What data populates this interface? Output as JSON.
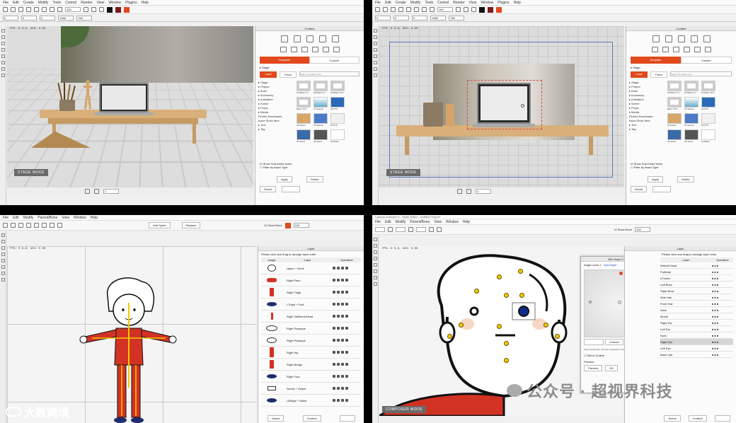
{
  "q1": {
    "menu": [
      "File",
      "Edit",
      "Create",
      "Modify",
      "Tools",
      "Control",
      "Render",
      "View",
      "Window",
      "Plugins",
      "Help"
    ],
    "toolbar": {
      "zoom": "100",
      "field_x": "0",
      "field_y": "0",
      "field_z": "0",
      "field_w": "1366",
      "field_h": "768"
    },
    "readout": "FPS: 0  0,0,  #E9: 0.00",
    "stage_label": "STAGE MODE",
    "panel": {
      "title": "Content",
      "tab_template": "Template",
      "tab_custom": "Custom",
      "path": "▸ Stage",
      "subtab_1": "Load",
      "subtab_2": "Favor",
      "search_placeholder": "Search Template View",
      "tree": [
        "▸ Stage",
        "  ▸ Project",
        "  ▸ Actor",
        "  ▸ Accessory",
        "  ▸ Animation",
        "  ▸ Scene",
        "  ▸ Props",
        "  ▸ Media",
        "  Pinned Downloads",
        "  Issue Stock Item",
        "",
        "▸ Tool",
        "▸ Tag"
      ],
      "thumbs": [
        "01 Blank 4:3",
        "02 Blank 4:3",
        "03 Blank 16:9",
        "Blank 16:9",
        "01 Startup",
        "02 PTP",
        "01 Dance",
        "04 Startup",
        "05 PTP",
        "04 Stand",
        "06 Stand",
        "01 Blank"
      ],
      "checkbox_1": "Show Sub-folder Items",
      "checkbox_2": "Filter by Asset Type",
      "btn_apply": "Apply",
      "btn_delete": "Delete"
    },
    "bottom": {
      "frame": "1",
      "btn_scene": "Scene",
      "btn_content": "Content"
    }
  },
  "q2": {
    "menu": [
      "File",
      "Edit",
      "Create",
      "Modify",
      "Tools",
      "Control",
      "Render",
      "View",
      "Window",
      "Plugins",
      "Help"
    ],
    "toolbar": {
      "zoom": "100",
      "field_x": "0",
      "field_y": "0",
      "field_z": "0",
      "field_w": "1366",
      "field_h": "768"
    },
    "readout": "FPS: 0  0,0,  #E9: 0.00",
    "stage_label": "STAGE MODE",
    "panel": {
      "title": "Content",
      "tab_template": "Template",
      "tab_custom": "Custom",
      "path": "▸ Stage",
      "subtab_1": "Load",
      "subtab_2": "Favor",
      "search_placeholder": "Search Template View",
      "tree": [
        "▸ Stage",
        "  ▸ Project",
        "  ▸ Actor",
        "  ▸ Accessory",
        "  ▸ Animation",
        "  ▸ Scene",
        "  ▸ Props",
        "  ▸ Media",
        "  Pinned Downloads",
        "  Issue Stock Item",
        "",
        "▸ Tool",
        "▸ Tag"
      ],
      "thumbs": [
        "01 Blank 4:3",
        "02 Blank 4:3",
        "03 Blank 16:9",
        "Blank 16:9",
        "01 Startup",
        "02 PTP",
        "01 Dance",
        "04 Startup",
        "05 PTP",
        "04 Stand",
        "06 Stand",
        "01 Blank"
      ],
      "checkbox_1": "Show Sub-folder Items",
      "checkbox_2": "Filter by Asset Type",
      "btn_apply": "Apply",
      "btn_delete": "Delete"
    },
    "bottom": {
      "frame": "1",
      "btn_scene": "Scene",
      "btn_content": "Content"
    }
  },
  "q3": {
    "menu": [
      "File",
      "Edit",
      "Modify",
      "Parent/Bone",
      "View",
      "Window",
      "Help"
    ],
    "toolbar": {
      "btn_add_sprite": "Add Sprite",
      "btn_replace": "Replace",
      "checkbox": "Show Bone",
      "zoom": "100"
    },
    "readout": "FPS: 0  0,0,  #E9: 0.00",
    "panel": {
      "title": "Layer",
      "hint": "Please click and drag to arrange layer order",
      "col_image": "Image",
      "col_layer": "Layer",
      "col_ops": "Operation",
      "layers": [
        "Upper + Neck",
        "Right Palm",
        "Right Thigh",
        "LThigh + Foot",
        "Right Tail/Neck/Head",
        "Right Physique",
        "Right Physique",
        "Right Hip",
        "Right Bridge",
        "Right Foot",
        "Sword + Helper",
        "LBridge + Waist"
      ],
      "btn_scene": "Scene",
      "btn_content": "Content",
      "btn_layer": "Layer"
    },
    "watermark": "大数跨境"
  },
  "q4": {
    "title": "Cartoon Animator 5 - Sprite Editor - Untitled Project*",
    "menu": [
      "File",
      "Edit",
      "Modify",
      "Parent/Bone",
      "View",
      "Window",
      "Help"
    ],
    "toolbar": {
      "checkbox": "Show Bone",
      "zoom": "100"
    },
    "readout": "FPS: 0  0,0,  #E9: 0.00",
    "composer_label": "COMPOSER MODE",
    "dialog": {
      "title": "360 Head Creator",
      "angle_label": "Angle Level 1",
      "btn_add": "Add Angle",
      "btn_template": "Template",
      "btn_custom": "Custom",
      "hint": "Link to Actionizer. Use the mouse/Ctrl to drag places with moving enabled",
      "checkbox": "Mirror Outline",
      "preview_label": "Preview",
      "btn_preview": "Preview",
      "btn_ok": "OK"
    },
    "panel": {
      "title": "Layer",
      "hint": "Please click and drag to arrange layer order",
      "col_layer": "Layer",
      "col_ops": "Operation",
      "layers": [
        "Default Head",
        "Fullbody",
        "LFlower",
        "Left Brow",
        "Right Brow",
        "Side Hair",
        "Front Hair",
        "Nose",
        "Mouth",
        "Right Ear",
        "Left Ear",
        "Eyes",
        "Right Eye",
        "Left Eye",
        "Back Hair"
      ],
      "btn_scene": "Scene",
      "btn_content": "Content",
      "btn_layer": "Layer"
    },
    "watermark": "公众号 · 超视界科技"
  },
  "colors": {
    "accent": "#e2491c",
    "jersey": "#d23224",
    "token": "#f5c800",
    "eye": "#0c2c8c"
  }
}
